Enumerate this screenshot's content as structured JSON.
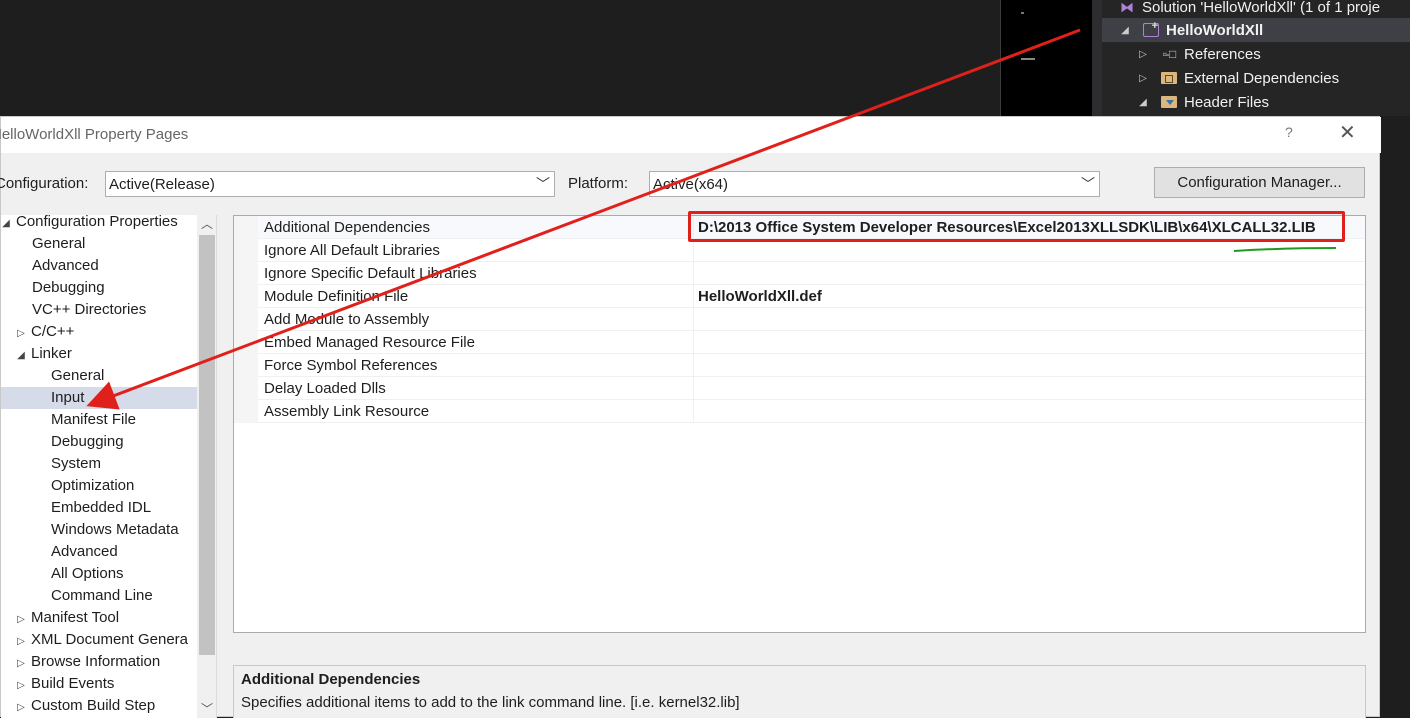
{
  "solution_explorer": {
    "items": [
      {
        "label": "Solution 'HelloWorldXll' (1 of 1 proje",
        "icon": "vs-solution-icon"
      },
      {
        "label": "HelloWorldXll",
        "icon": "project-icon"
      },
      {
        "label": "References",
        "icon": "references-icon"
      },
      {
        "label": "External Dependencies",
        "icon": "external-deps-icon"
      },
      {
        "label": "Header Files",
        "icon": "header-folder-icon"
      }
    ]
  },
  "dialog": {
    "title": "HelloWorldXll Property Pages",
    "help_label": "?",
    "close_label": "✕",
    "configuration_label": "Configuration:",
    "configuration_value": "Active(Release)",
    "platform_label": "Platform:",
    "platform_value": "Active(x64)",
    "config_manager_label": "Configuration Manager..."
  },
  "tree": {
    "items": [
      {
        "label": "Configuration Properties",
        "expander": "◢"
      },
      {
        "label": "General"
      },
      {
        "label": "Advanced"
      },
      {
        "label": "Debugging"
      },
      {
        "label": "VC++ Directories"
      },
      {
        "label": "C/C++",
        "expander": "▷"
      },
      {
        "label": "Linker",
        "expander": "◢"
      },
      {
        "label": "General"
      },
      {
        "label": "Input",
        "selected": true
      },
      {
        "label": "Manifest File"
      },
      {
        "label": "Debugging"
      },
      {
        "label": "System"
      },
      {
        "label": "Optimization"
      },
      {
        "label": "Embedded IDL"
      },
      {
        "label": "Windows Metadata"
      },
      {
        "label": "Advanced"
      },
      {
        "label": "All Options"
      },
      {
        "label": "Command Line"
      },
      {
        "label": "Manifest Tool",
        "expander": "▷"
      },
      {
        "label": "XML Document Genera",
        "expander": "▷"
      },
      {
        "label": "Browse Information",
        "expander": "▷"
      },
      {
        "label": "Build Events",
        "expander": "▷"
      },
      {
        "label": "Custom Build Step",
        "expander": "▷"
      }
    ]
  },
  "properties": [
    {
      "name": "Additional Dependencies",
      "value": "D:\\2013 Office System Developer Resources\\Excel2013XLLSDK\\LIB\\x64\\XLCALL32.LIB"
    },
    {
      "name": "Ignore All Default Libraries",
      "value": ""
    },
    {
      "name": "Ignore Specific Default Libraries",
      "value": ""
    },
    {
      "name": "Module Definition File",
      "value": "HelloWorldXll.def"
    },
    {
      "name": "Add Module to Assembly",
      "value": ""
    },
    {
      "name": "Embed Managed Resource File",
      "value": ""
    },
    {
      "name": "Force Symbol References",
      "value": ""
    },
    {
      "name": "Delay Loaded Dlls",
      "value": ""
    },
    {
      "name": "Assembly Link Resource",
      "value": ""
    }
  ],
  "description": {
    "title": "Additional Dependencies",
    "text": "Specifies additional items to add to the link command line. [i.e. kernel32.lib]"
  },
  "colors": {
    "annotation_red": "#e0201b",
    "underline_green": "#1f9a1f",
    "selection": "#d6dbe9"
  }
}
